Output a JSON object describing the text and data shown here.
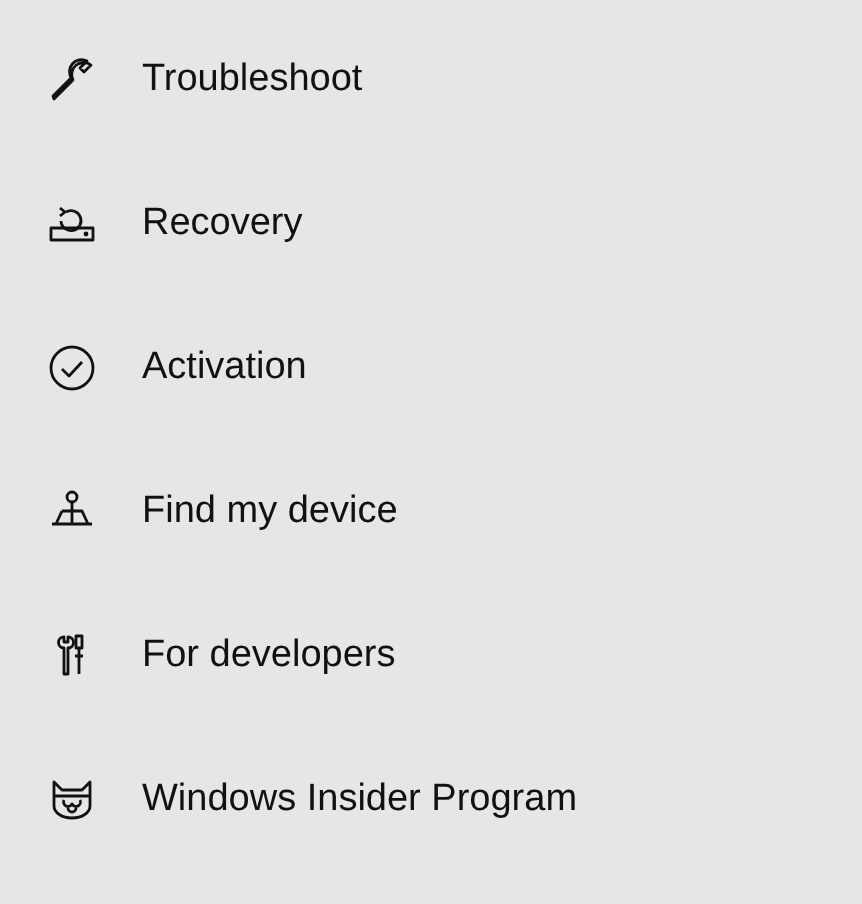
{
  "menu": {
    "items": [
      {
        "label": "Troubleshoot"
      },
      {
        "label": "Recovery"
      },
      {
        "label": "Activation"
      },
      {
        "label": "Find my device"
      },
      {
        "label": "For developers"
      },
      {
        "label": "Windows Insider Program"
      }
    ]
  }
}
